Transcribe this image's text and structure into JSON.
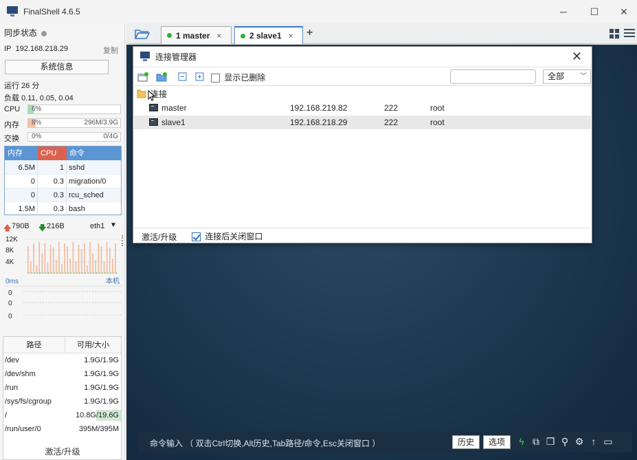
{
  "window": {
    "title": "FinalShell 4.6.5",
    "controls": [
      "─",
      "☐",
      "✕"
    ]
  },
  "left": {
    "sync_label": "同步状态",
    "ip_label": "IP",
    "ip_value": "192.168.218.29",
    "copy_label": "复制",
    "sysinfo_button": "系统信息",
    "uptime": "运行 26 分",
    "load": "负载 0.11, 0.05, 0.04",
    "cpu": {
      "label": "CPU",
      "percent_text": "6%",
      "percent": 6
    },
    "mem": {
      "label": "内存",
      "percent_text": "8%",
      "detail": "296M/3.9G",
      "percent": 8
    },
    "swap": {
      "label": "交换",
      "percent_text": "0%",
      "detail": "0/4G",
      "percent": 0
    },
    "process_headers": [
      "内存",
      "CPU",
      "命令"
    ],
    "processes": [
      {
        "mem": "6.5M",
        "cpu": "1",
        "cmd": "sshd"
      },
      {
        "mem": "0",
        "cpu": "0.3",
        "cmd": "migration/0"
      },
      {
        "mem": "0",
        "cpu": "0.3",
        "cmd": "rcu_sched"
      },
      {
        "mem": "1.5M",
        "cpu": "0.3",
        "cmd": "bash"
      }
    ],
    "net_up": "790B",
    "net_down": "216B",
    "net_iface": "eth1",
    "net_ticks": [
      "12K",
      "8K",
      "4K"
    ],
    "ping_label": "0ms",
    "ping_target": "本机",
    "ping_ticks": [
      "0",
      "0",
      "0"
    ],
    "disk_headers": [
      "路径",
      "可用/大小"
    ],
    "disks": [
      {
        "path": "/dev",
        "size": "1.9G/1.9G",
        "used_fraction": 0
      },
      {
        "path": "/dev/shm",
        "size": "1.9G/1.9G",
        "used_fraction": 0
      },
      {
        "path": "/run",
        "size": "1.9G/1.9G",
        "used_fraction": 0
      },
      {
        "path": "/sys/fs/cgroup",
        "size": "1.9G/1.9G",
        "used_fraction": 0
      },
      {
        "path": "/",
        "size": "10.8G/19.6G",
        "used_fraction": 0.45
      },
      {
        "path": "/run/user/0",
        "size": "395M/395M",
        "used_fraction": 0
      }
    ],
    "activate": "激活/升级"
  },
  "tabs": [
    {
      "label": "1 master",
      "close": "×"
    },
    {
      "label": "2 slave1",
      "close": "×"
    }
  ],
  "add_tab": "+",
  "dialog": {
    "title": "连接管理器",
    "close": "✕",
    "show_deleted_label": "显示已删除",
    "filter_value": "全部",
    "folder_label": "连接",
    "connections": [
      {
        "name": "master",
        "host": "192.168.219.82",
        "port": "222",
        "user": "root"
      },
      {
        "name": "slave1",
        "host": "192.168.218.29",
        "port": "222",
        "user": "root"
      }
    ],
    "footer_activate": "激活/升级",
    "close_after_connect_label": "连接后关闭窗口"
  },
  "cmdbar": {
    "hint": "命令输入 （ 双击Ctrl切换,Alt历史,Tab路径/命令,Esc关闭窗口 ）",
    "history_button": "历史",
    "options_button": "选项"
  },
  "colors": {
    "cpu_fill": "#a8dcb4",
    "mem_fill": "#f5c2a8",
    "proc_header_mem": "#5b95d4",
    "proc_header_cpu": "#d9634f",
    "proc_header_cmd": "#5b95d4",
    "tab_dot": "#2db52d"
  }
}
